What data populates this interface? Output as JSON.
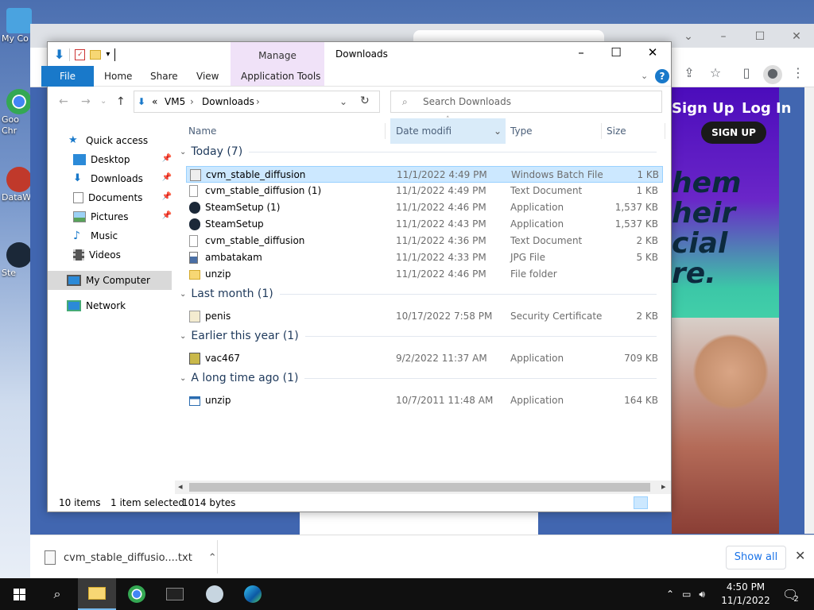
{
  "desktop": {
    "icons": [
      {
        "name": "my-computer",
        "label": "My Co",
        "color": "#4aa3e0"
      },
      {
        "name": "google-chrome",
        "label": "Goo Chr",
        "color": "#e8453c"
      },
      {
        "name": "datawrapper",
        "label": "DataW",
        "color": "#c0392b"
      },
      {
        "name": "steam",
        "label": "Ste",
        "color": "#1b2838"
      }
    ]
  },
  "chrome": {
    "ad": {
      "signup_top": "Sign Up",
      "login": "Log In",
      "signup_button": "SIGN UP",
      "headline_lines": [
        "hem",
        "heir",
        "cial",
        "re."
      ]
    }
  },
  "download_bar": {
    "file_name": "cvm_stable_diffusio....txt",
    "show_all": "Show all"
  },
  "explorer": {
    "title": "Downloads",
    "manage_tab": "Manage",
    "ribbon_tabs": [
      "File",
      "Home",
      "Share",
      "View",
      "Application Tools"
    ],
    "address": {
      "prefix": "«",
      "crumbs": [
        "VM5",
        "Downloads"
      ]
    },
    "search_placeholder": "Search Downloads",
    "nav": [
      {
        "label": "Quick access",
        "icon": "star-icon",
        "pinned": false
      },
      {
        "label": "Desktop",
        "icon": "desktop-icon",
        "pinned": true
      },
      {
        "label": "Downloads",
        "icon": "download-icon",
        "pinned": true
      },
      {
        "label": "Documents",
        "icon": "document-icon",
        "pinned": true
      },
      {
        "label": "Pictures",
        "icon": "picture-icon",
        "pinned": true
      },
      {
        "label": "Music",
        "icon": "music-icon",
        "pinned": false
      },
      {
        "label": "Videos",
        "icon": "video-icon",
        "pinned": false
      },
      {
        "label": "My Computer",
        "icon": "computer-icon",
        "pinned": false,
        "selected": true
      },
      {
        "label": "Network",
        "icon": "network-icon",
        "pinned": false
      }
    ],
    "columns": [
      "Name",
      "Date modifi",
      "Type",
      "Size"
    ],
    "groups": [
      {
        "label": "Today (7)",
        "files": [
          {
            "name": "cvm_stable_diffusion",
            "date": "11/1/2022 4:49 PM",
            "type": "Windows Batch File",
            "size": "1 KB",
            "icon": "batch-file-icon",
            "selected": true
          },
          {
            "name": "cvm_stable_diffusion (1)",
            "date": "11/1/2022 4:49 PM",
            "type": "Text Document",
            "size": "1 KB",
            "icon": "text-file-icon"
          },
          {
            "name": "SteamSetup (1)",
            "date": "11/1/2022 4:46 PM",
            "type": "Application",
            "size": "1,537 KB",
            "icon": "steam-icon"
          },
          {
            "name": "SteamSetup",
            "date": "11/1/2022 4:43 PM",
            "type": "Application",
            "size": "1,537 KB",
            "icon": "steam-icon"
          },
          {
            "name": "cvm_stable_diffusion",
            "date": "11/1/2022 4:36 PM",
            "type": "Text Document",
            "size": "2 KB",
            "icon": "text-file-icon"
          },
          {
            "name": "ambatakam",
            "date": "11/1/2022 4:33 PM",
            "type": "JPG File",
            "size": "5 KB",
            "icon": "image-file-icon"
          },
          {
            "name": "unzip",
            "date": "11/1/2022 4:46 PM",
            "type": "File folder",
            "size": "",
            "icon": "folder-icon"
          }
        ]
      },
      {
        "label": "Last month (1)",
        "files": [
          {
            "name": "penis",
            "date": "10/17/2022 7:58 PM",
            "type": "Security Certificate",
            "size": "2 KB",
            "icon": "certificate-icon"
          }
        ]
      },
      {
        "label": "Earlier this year (1)",
        "files": [
          {
            "name": "vac467",
            "date": "9/2/2022 11:37 AM",
            "type": "Application",
            "size": "709 KB",
            "icon": "app-icon"
          }
        ]
      },
      {
        "label": "A long time ago (1)",
        "files": [
          {
            "name": "unzip",
            "date": "10/7/2011 11:48 AM",
            "type": "Application",
            "size": "164 KB",
            "icon": "app-window-icon"
          }
        ]
      }
    ],
    "status": {
      "items": "10 items",
      "selected": "1 item selected",
      "bytes": "1014 bytes"
    }
  },
  "taskbar": {
    "time": "4:50 PM",
    "date": "11/1/2022",
    "notifications": "2"
  },
  "colors": {
    "accent": "#1979ca",
    "selection": "#cce8ff",
    "taskbar": "#101010"
  }
}
